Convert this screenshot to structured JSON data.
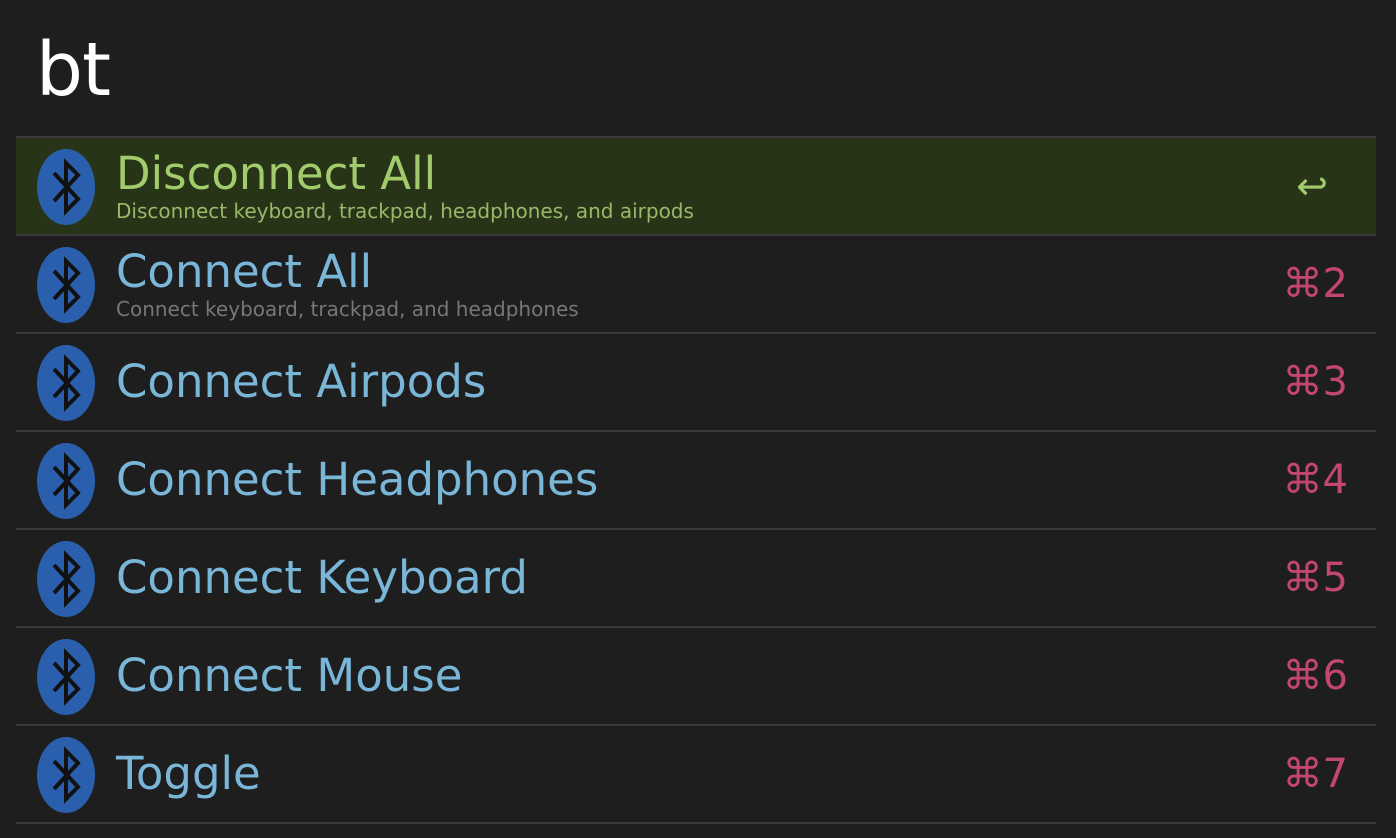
{
  "search": {
    "query": "bt"
  },
  "results": [
    {
      "title": "Disconnect All",
      "subtitle": "Disconnect keyboard, trackpad, headphones, and airpods",
      "shortcut": "↩",
      "icon": "bluetooth-icon",
      "selected": true
    },
    {
      "title": "Connect All",
      "subtitle": "Connect keyboard, trackpad, and headphones",
      "shortcut": "⌘2",
      "icon": "bluetooth-icon",
      "selected": false
    },
    {
      "title": "Connect Airpods",
      "shortcut": "⌘3",
      "icon": "bluetooth-icon",
      "selected": false
    },
    {
      "title": "Connect Headphones",
      "shortcut": "⌘4",
      "icon": "bluetooth-icon",
      "selected": false
    },
    {
      "title": "Connect Keyboard",
      "shortcut": "⌘5",
      "icon": "bluetooth-icon",
      "selected": false
    },
    {
      "title": "Connect Mouse",
      "shortcut": "⌘6",
      "icon": "bluetooth-icon",
      "selected": false
    },
    {
      "title": "Toggle",
      "shortcut": "⌘7",
      "icon": "bluetooth-icon",
      "selected": false
    }
  ],
  "colors": {
    "background": "#1e1e1e",
    "selected_background": "#283418",
    "title": "#79b6d8",
    "selected_title": "#a2cc6c",
    "subtitle": "#777777",
    "shortcut": "#c2466e",
    "bluetooth_blue": "#2a5fae"
  }
}
